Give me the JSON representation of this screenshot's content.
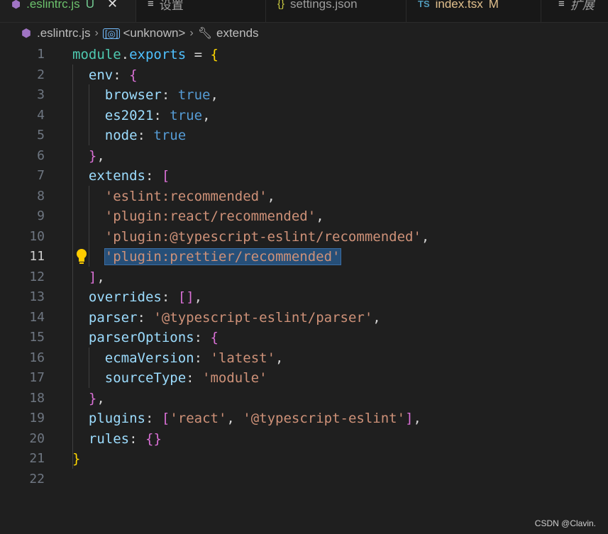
{
  "tabs": [
    {
      "icon": "eslint-icon",
      "label": ".eslintrc.js",
      "badge": "U",
      "active": true,
      "close": "✕"
    },
    {
      "icon": "settings-icon",
      "label": "设置",
      "active": false
    },
    {
      "icon": "json-icon",
      "label": "settings.json",
      "active": false
    },
    {
      "icon": "typescript-icon",
      "label": "index.tsx",
      "badge": "M",
      "active": false
    },
    {
      "icon": "extension-icon",
      "label": "扩展",
      "active": false
    }
  ],
  "breadcrumb": {
    "file": ".eslintrc.js",
    "symbol": "<unknown>",
    "property": "extends"
  },
  "line_numbers": [
    "1",
    "2",
    "3",
    "4",
    "5",
    "6",
    "7",
    "8",
    "9",
    "10",
    "11",
    "12",
    "13",
    "14",
    "15",
    "16",
    "17",
    "18",
    "19",
    "20",
    "21",
    "22"
  ],
  "current_line": "11",
  "code_lines": [
    "module.exports = {",
    "  env: {",
    "    browser: true,",
    "    es2021: true,",
    "    node: true",
    "  },",
    "  extends: [",
    "    'eslint:recommended',",
    "    'plugin:react/recommended',",
    "    'plugin:@typescript-eslint/recommended',",
    "    'plugin:prettier/recommended'",
    "  ],",
    "  overrides: [],",
    "  parser: '@typescript-eslint/parser',",
    "  parserOptions: {",
    "    ecmaVersion: 'latest',",
    "    sourceType: 'module'",
    "  },",
    "  plugins: ['react', '@typescript-eslint'],",
    "  rules: {}",
    "}",
    ""
  ],
  "selected_text": "'plugin:prettier/recommended'",
  "watermark": "CSDN @Clavin.",
  "colors": {
    "background": "#1f1f1f",
    "keyword_property": "#9cdcfe",
    "string": "#ce9178",
    "boolean": "#569cd6",
    "selection": "#264f78"
  }
}
